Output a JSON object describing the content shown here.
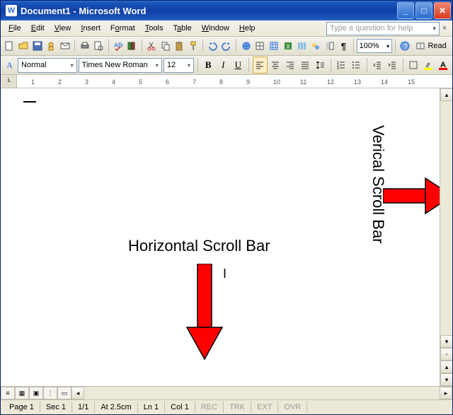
{
  "titlebar": {
    "title": "Document1 - Microsoft Word"
  },
  "menubar": {
    "items": [
      "File",
      "Edit",
      "View",
      "Insert",
      "Format",
      "Tools",
      "Table",
      "Window",
      "Help"
    ],
    "help_placeholder": "Type a question for help"
  },
  "toolbar1": {
    "zoom": "100%",
    "read_label": "Read"
  },
  "formatbar": {
    "style_label": "Normal",
    "font_label": "Times New Roman",
    "size_label": "12"
  },
  "ruler": {
    "numbers": [
      "1",
      "2",
      "3",
      "4",
      "5",
      "6",
      "7",
      "8",
      "9",
      "10",
      "11",
      "12",
      "13",
      "14",
      "15"
    ]
  },
  "annotations": {
    "horizontal": "Horizontal Scroll Bar",
    "vertical": "Verical Scroll Bar"
  },
  "statusbar": {
    "page": "Page  1",
    "sec": "Sec 1",
    "pages": "1/1",
    "at": "At  2.5cm",
    "ln": "Ln  1",
    "col": "Col  1",
    "rec": "REC",
    "trk": "TRK",
    "ext": "EXT",
    "ovr": "OVR"
  },
  "colors": {
    "accent": "#1c56b8",
    "arrow": "#ff0000"
  }
}
